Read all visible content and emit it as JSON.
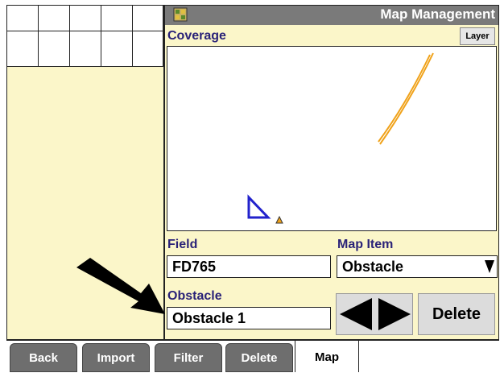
{
  "header": {
    "title": "Map Management",
    "icon": "field-map-icon"
  },
  "coverage": {
    "label": "Coverage",
    "layer_button": "Layer"
  },
  "field": {
    "label": "Field",
    "value": "FD765"
  },
  "map_item": {
    "label": "Map Item",
    "value": "Obstacle"
  },
  "obstacle": {
    "label": "Obstacle",
    "value": "Obstacle 1"
  },
  "controls": {
    "prev": "previous-arrow-icon",
    "next": "next-arrow-icon",
    "delete_label": "Delete"
  },
  "tabs": [
    {
      "label": "Back"
    },
    {
      "label": "Import"
    },
    {
      "label": "Filter"
    },
    {
      "label": "Delete"
    },
    {
      "label": "Map",
      "active": true
    }
  ],
  "colors": {
    "header_bg": "#7a7a7a",
    "panel_bg": "#fbf6c9",
    "label": "#2a2278",
    "track": "#f0a21a",
    "marker": "#2222cc"
  }
}
